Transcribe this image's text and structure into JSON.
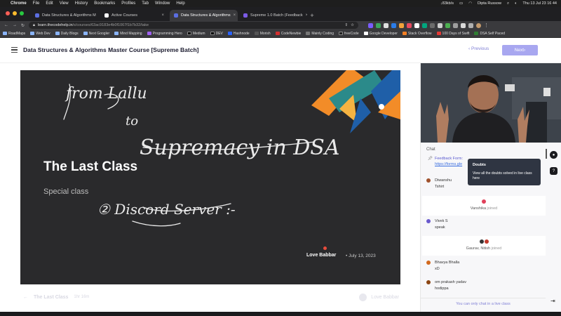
{
  "menubar": {
    "app": "Chrome",
    "menus": [
      "File",
      "Edit",
      "View",
      "History",
      "Bookmarks",
      "Profiles",
      "Tab",
      "Window",
      "Help"
    ],
    "right": {
      "speed": "↓83kb/s",
      "user": "Dipta Russow",
      "datetime": "Thu 13 Jul  23 16 44"
    }
  },
  "tabs": [
    {
      "title": "Data Structures & Algorithms M",
      "active": false,
      "color": "#5b6ee1"
    },
    {
      "title": "Active Courses",
      "active": false,
      "color": "#ffffff"
    },
    {
      "title": "Data Structures & Algorithms",
      "active": true,
      "color": "#5b6ee1"
    },
    {
      "title": "Supreme 1.0 Batch (Feedback",
      "active": false,
      "color": "#7b5be6"
    }
  ],
  "url": {
    "host": "learn.thecodehelp.in",
    "path": "/s/courses/63ac9183e4b0f1067f1b7b32/take"
  },
  "bookmarks": [
    "RoadMaps",
    "Web Dev",
    "Daily Blogs",
    "Next Googler",
    "Mind Mapping",
    "Programming Hero",
    "Medium",
    "DEV",
    "Hashnode",
    "Morish",
    "CodeNewbie",
    "Mainly Coding",
    "freeCode",
    "Google Developer",
    "Stack Overflow",
    "100 Days of Swift",
    "DSA Self Paced"
  ],
  "header": {
    "title": "Data Structures & Algorithms Master Course [Supreme Batch]",
    "prev": "Previous",
    "next": "Next"
  },
  "video": {
    "title": "The Last Class",
    "subtitle": "Special class",
    "handwriting": {
      "line1": "from Lallu",
      "line2": "to",
      "line3": "Supremacy in DSA",
      "line4": "② Discord Server :-"
    },
    "author": "Love Babbar",
    "date": "July 13, 2023"
  },
  "below_video": {
    "lesson": "The Last Class",
    "duration": "1hr 16m",
    "author": "Love Babbar"
  },
  "chat": {
    "label": "Chat",
    "pinned": {
      "title": "Feedback Form:",
      "link": "https://forms.gle"
    },
    "messages": [
      {
        "name": "Diwanshu",
        "text": "Tshirt",
        "color": "#a0522d"
      },
      {
        "name": "Vivek S",
        "text": "speak",
        "color": "#6a5acd"
      },
      {
        "name": "Bhavya Bhalla",
        "text": "xD",
        "color": "#d2691e"
      },
      {
        "name": "om prakash yadav",
        "text": "hodippa",
        "color": "#8b4513"
      }
    ],
    "joined1": {
      "name": "Vanshika",
      "action": "joined"
    },
    "joined2": {
      "name": "Gaurav, Nitish",
      "action": "joined"
    },
    "footer": "You can only chat in a live class"
  },
  "tooltip": {
    "title": "Doubts",
    "text": "View all the doubts solved in live class here"
  }
}
